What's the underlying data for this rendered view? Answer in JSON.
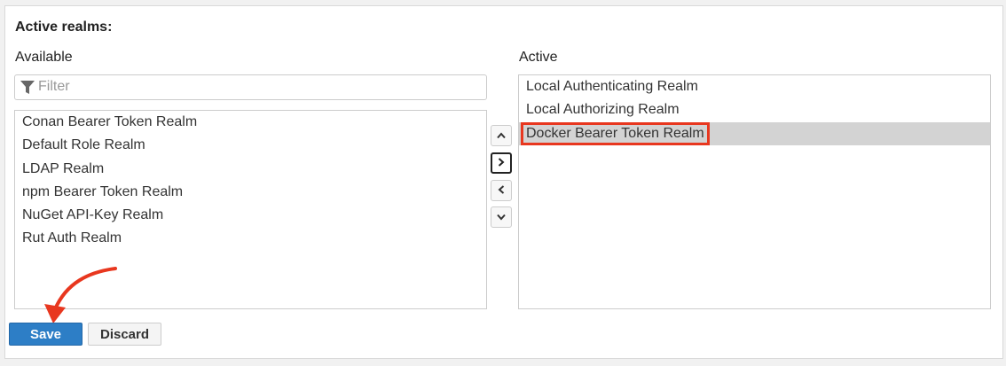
{
  "section_title": "Active realms:",
  "available": {
    "label": "Available",
    "filter_placeholder": "Filter",
    "items": [
      {
        "label": "Conan Bearer Token Realm"
      },
      {
        "label": "Default Role Realm"
      },
      {
        "label": "LDAP Realm"
      },
      {
        "label": "npm Bearer Token Realm"
      },
      {
        "label": "NuGet API-Key Realm"
      },
      {
        "label": "Rut Auth Realm"
      }
    ]
  },
  "active": {
    "label": "Active",
    "items": [
      {
        "label": "Local Authenticating Realm"
      },
      {
        "label": "Local Authorizing Realm"
      },
      {
        "label": "Docker Bearer Token Realm",
        "selected": true
      }
    ]
  },
  "move_buttons": [
    {
      "icon": "chevron-up-icon"
    },
    {
      "icon": "chevron-right-icon",
      "focused": true
    },
    {
      "icon": "chevron-left-icon"
    },
    {
      "icon": "chevron-down-icon"
    }
  ],
  "actions": {
    "save_label": "Save",
    "discard_label": "Discard"
  },
  "colors": {
    "primary": "#2d7ec6",
    "selection": "#d3d3d3",
    "annotation": "#e8371f"
  }
}
